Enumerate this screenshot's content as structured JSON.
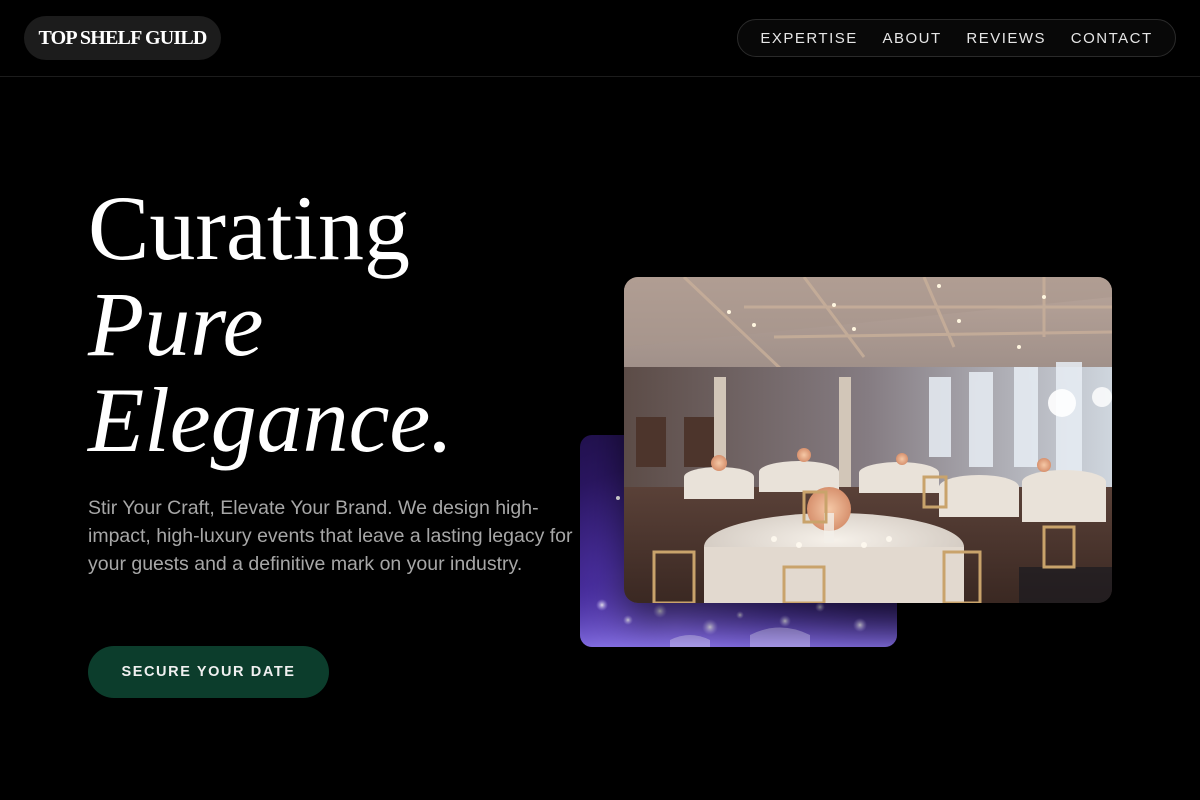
{
  "brand": {
    "name": "TOP SHELF GUILD"
  },
  "nav": {
    "items": [
      {
        "label": "EXPERTISE"
      },
      {
        "label": "ABOUT"
      },
      {
        "label": "REVIEWS"
      },
      {
        "label": "CONTACT"
      }
    ]
  },
  "hero": {
    "headline_line1": "Curating",
    "headline_line2": "Pure",
    "headline_line3": "Elegance.",
    "description": "Stir Your Craft, Elevate Your Brand. We design high-impact, high-luxury events that leave a lasting legacy for your guests and a definitive mark on your industry.",
    "cta_label": "SECURE YOUR DATE"
  },
  "colors": {
    "background": "#000000",
    "cta_background": "#0c3d2c",
    "description_text": "#a7a7a7",
    "heading_text": "#ffffff"
  },
  "images": {
    "front": "banquet-hall-photo",
    "back": "purple-lit-table-photo"
  }
}
